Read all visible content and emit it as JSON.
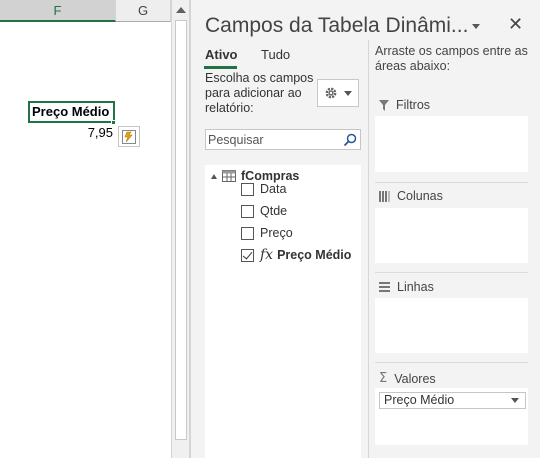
{
  "sheet": {
    "columns": [
      "F",
      "G"
    ],
    "selected_cell_text": "Preço Médio",
    "value_cell_text": "7,95",
    "quick_analysis_icon": "quick-analysis-icon"
  },
  "pane": {
    "title": "Campos da Tabela Dinâmi...",
    "tabs": {
      "active": "Ativo",
      "all": "Tudo"
    },
    "choose_fields": "Escolha os campos para adicionar ao relatório:",
    "search_placeholder": "Pesquisar",
    "table_name": "fCompras",
    "fields": [
      {
        "label": "Data",
        "checked": false
      },
      {
        "label": "Qtde",
        "checked": false
      },
      {
        "label": "Preço",
        "checked": false
      },
      {
        "label": "Preço Médio",
        "checked": true,
        "calculated": true
      }
    ],
    "fx_symbol": "fx",
    "drag_fields": "Arraste os campos entre as áreas abaixo:",
    "areas": {
      "filters": "Filtros",
      "columns": "Colunas",
      "rows": "Linhas",
      "values": "Valores"
    },
    "values_item": "Preço Médio",
    "close_symbol": "✕"
  },
  "colors": {
    "accent_green": "#217346",
    "pane_background": "#f3f3f3"
  }
}
